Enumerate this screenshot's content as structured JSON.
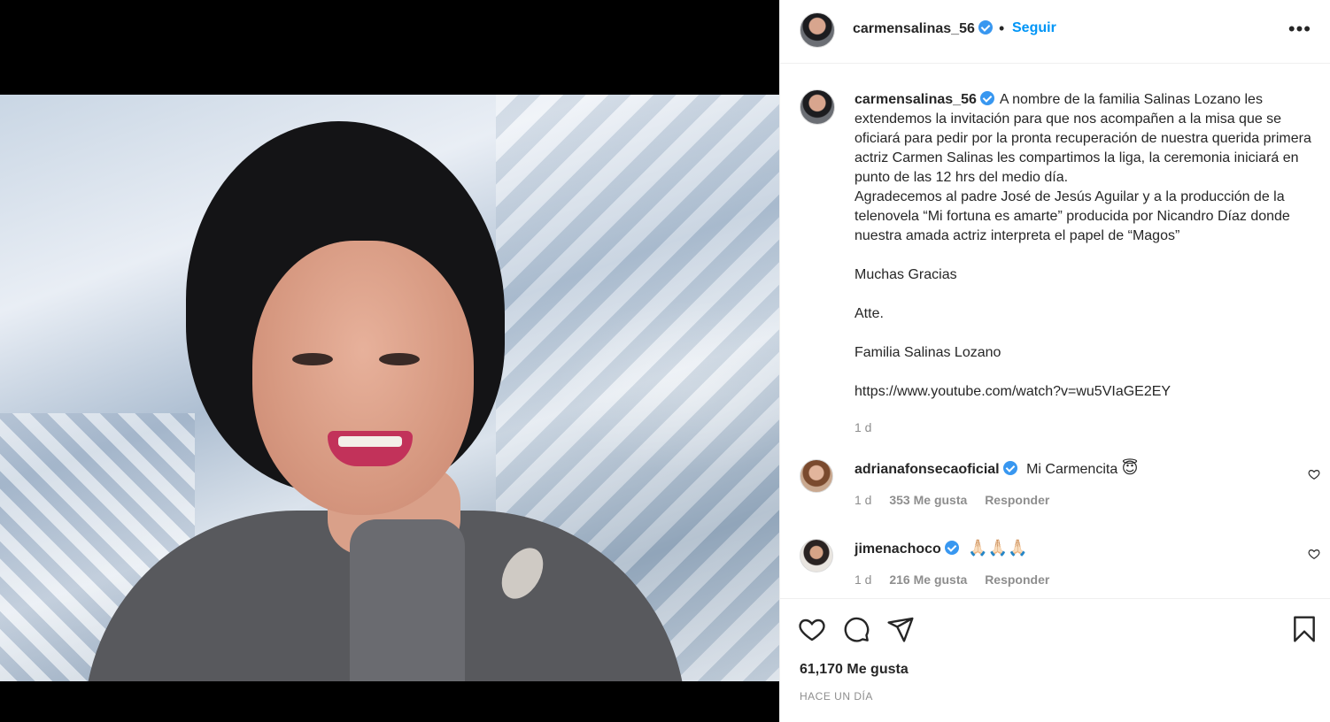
{
  "post": {
    "username": "carmensalinas_56",
    "follow_label": "Seguir",
    "more_label": "•••",
    "separator": "•"
  },
  "caption": {
    "username": "carmensalinas_56",
    "text": "A nombre de la familia Salinas Lozano les extendemos la invitación para que nos acompañen a la misa que se oficiará para pedir por la pronta recuperación de nuestra querida primera actriz Carmen Salinas les compartimos la liga, la ceremonia iniciará en punto de las 12 hrs del medio día.\nAgradecemos al padre José de Jesús Aguilar y a la producción de la telenovela “Mi fortuna es amarte” producida por Nicandro Díaz donde nuestra amada actriz interpreta el papel de “Magos”\n\nMuchas Gracias\n\nAtte.\n\nFamilia Salinas Lozano\n\nhttps://www.youtube.com/watch?v=wu5VIaGE2EY",
    "time": "1 d"
  },
  "comments": [
    {
      "username": "adrianafonsecaoficial",
      "text": "Mi Carmencita",
      "emoji": "😇",
      "time": "1 d",
      "likes": "353 Me gusta",
      "reply": "Responder"
    },
    {
      "username": "jimenachoco",
      "text": "",
      "emoji": "🙏🏻🙏🏻🙏🏻",
      "time": "1 d",
      "likes": "216 Me gusta",
      "reply": "Responder"
    }
  ],
  "footer": {
    "likes": "61,170 Me gusta",
    "ago": "HACE UN DÍA"
  },
  "icons": [
    "heart-icon",
    "comment-icon",
    "share-icon",
    "bookmark-icon",
    "verified-icon",
    "more-icon"
  ],
  "colors": {
    "link": "#0095f6",
    "verified": "#3897f0",
    "muted": "#8e8e8e",
    "text": "#262626"
  }
}
